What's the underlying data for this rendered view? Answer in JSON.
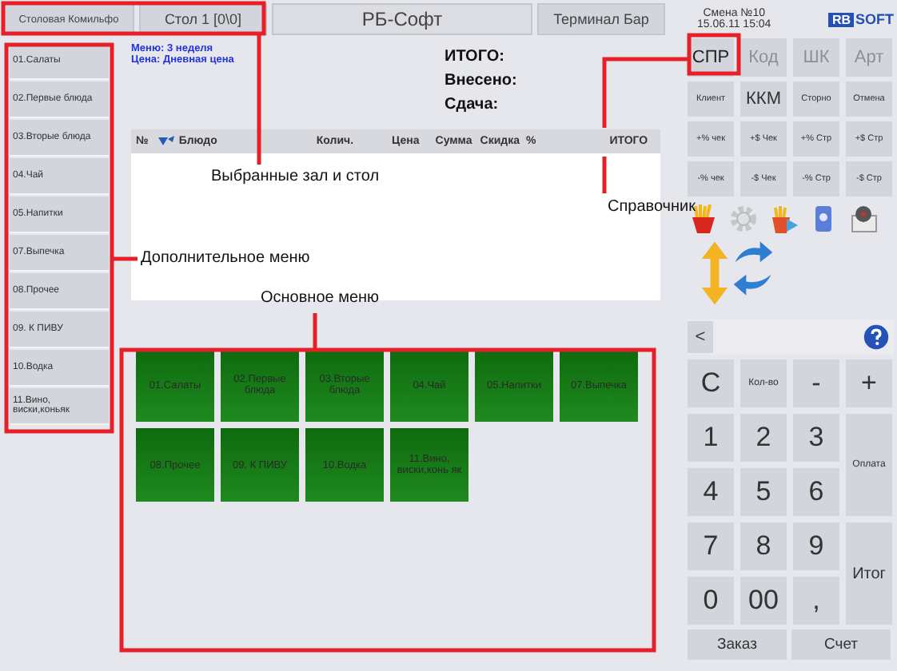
{
  "header": {
    "hall": "Столовая Комильфо",
    "table": "Стол 1 [0\\0]",
    "app_title": "РБ-Софт",
    "terminal": "Терминал Бар"
  },
  "shift": {
    "number": "Смена №10",
    "datetime": "15.06.11 15:04"
  },
  "logo": {
    "badge": "RB",
    "text": "SOFT"
  },
  "sidebar": {
    "items": [
      {
        "label": "01.Салаты"
      },
      {
        "label": "02.Первые блюда"
      },
      {
        "label": "03.Вторые блюда"
      },
      {
        "label": "04.Чай"
      },
      {
        "label": "05.Напитки"
      },
      {
        "label": "07.Выпечка"
      },
      {
        "label": "08.Прочее"
      },
      {
        "label": "09. К ПИВУ"
      },
      {
        "label": "10.Водка"
      },
      {
        "label": "11.Вино, виски,коньяк"
      }
    ]
  },
  "info": {
    "menu": "Меню: 3 неделя",
    "price": "Цена: Дневная цена"
  },
  "totals": [
    {
      "label": "ИТОГО:"
    },
    {
      "label": "Внесено:"
    },
    {
      "label": "Сдача:"
    }
  ],
  "table": {
    "columns": [
      "№",
      "Блюдо",
      "Колич.",
      "Цена",
      "Сумма",
      "Скидка",
      "%",
      "ИТОГО"
    ]
  },
  "main_menu": [
    {
      "label": "01.Салаты"
    },
    {
      "label": "02.Первые блюда"
    },
    {
      "label": "03.Вторые блюда"
    },
    {
      "label": "04.Чай"
    },
    {
      "label": "05.Напитки"
    },
    {
      "label": "07.Выпечка"
    },
    {
      "label": "08.Прочее"
    },
    {
      "label": "09. К ПИВУ"
    },
    {
      "label": "10.Водка"
    },
    {
      "label": "11.Вино, виски,конь як"
    }
  ],
  "modes": [
    {
      "label": "СПР",
      "disabled": false
    },
    {
      "label": "Код",
      "disabled": true
    },
    {
      "label": "ШК",
      "disabled": true
    },
    {
      "label": "Арт",
      "disabled": true
    }
  ],
  "functions": [
    {
      "label": "Клиент",
      "kind": "small"
    },
    {
      "label": "ККМ",
      "kind": "large"
    },
    {
      "label": "Сторно",
      "kind": "small"
    },
    {
      "label": "Отмена",
      "kind": "small"
    },
    {
      "label": "+% чек",
      "kind": "small"
    },
    {
      "label": "+$ Чек",
      "kind": "small"
    },
    {
      "label": "+% Стр",
      "kind": "small"
    },
    {
      "label": "+$ Стр",
      "kind": "small"
    },
    {
      "label": "-% чек",
      "kind": "small"
    },
    {
      "label": "-$ Чек",
      "kind": "small"
    },
    {
      "label": "-% Стр",
      "kind": "small"
    },
    {
      "label": "-$ Стр",
      "kind": "small"
    }
  ],
  "input": {
    "back": "<"
  },
  "keypad": [
    {
      "label": "C",
      "kind": "digit"
    },
    {
      "label": "Кол-во",
      "kind": "small"
    },
    {
      "label": "-",
      "kind": "digit"
    },
    {
      "label": "+",
      "kind": "digit"
    },
    {
      "label": "1",
      "kind": "digit"
    },
    {
      "label": "2",
      "kind": "digit"
    },
    {
      "label": "3",
      "kind": "digit"
    },
    {
      "label": "Оплата",
      "kind": "tall-small"
    },
    {
      "label": "4",
      "kind": "digit"
    },
    {
      "label": "5",
      "kind": "digit"
    },
    {
      "label": "6",
      "kind": "digit"
    },
    {
      "label": "7",
      "kind": "digit"
    },
    {
      "label": "8",
      "kind": "digit"
    },
    {
      "label": "9",
      "kind": "digit"
    },
    {
      "label": "Итог",
      "kind": "tall"
    },
    {
      "label": "0",
      "kind": "digit"
    },
    {
      "label": "00",
      "kind": "digit"
    },
    {
      "label": ",",
      "kind": "digit"
    }
  ],
  "bottom_buttons": [
    "Заказ",
    "Счет"
  ],
  "annotations": [
    {
      "label": "Выбранные зал и стол"
    },
    {
      "label": "Справочник"
    },
    {
      "label": "Дополнительное меню"
    },
    {
      "label": "Основное меню"
    }
  ]
}
